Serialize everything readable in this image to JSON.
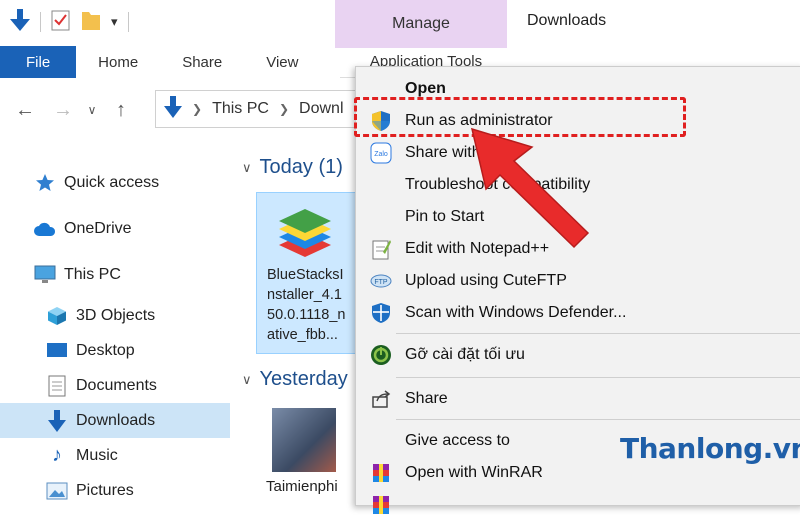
{
  "window": {
    "title": "Downloads"
  },
  "ribbon": {
    "manage_label": "Manage",
    "tabs": [
      {
        "label": "File"
      },
      {
        "label": "Home"
      },
      {
        "label": "Share"
      },
      {
        "label": "View"
      },
      {
        "label": "Application Tools"
      }
    ]
  },
  "address": {
    "crumbs": [
      "This PC",
      "Downl"
    ]
  },
  "sidebar": {
    "items": [
      {
        "label": "Quick access",
        "icon": "star-icon"
      },
      {
        "label": "OneDrive",
        "icon": "cloud-icon"
      },
      {
        "label": "This PC",
        "icon": "monitor-icon"
      },
      {
        "label": "3D Objects",
        "icon": "cube-icon"
      },
      {
        "label": "Desktop",
        "icon": "desktop-icon"
      },
      {
        "label": "Documents",
        "icon": "document-icon"
      },
      {
        "label": "Downloads",
        "icon": "download-icon",
        "selected": true
      },
      {
        "label": "Music",
        "icon": "music-icon"
      },
      {
        "label": "Pictures",
        "icon": "pictures-icon"
      }
    ]
  },
  "content": {
    "today_label": "Today (1)",
    "yesterday_label": "Yesterday",
    "file_name": "BlueStacksI\nnstaller_4.1\n50.0.1118_n\native_fbb...",
    "thumb_name": "Taimienphi"
  },
  "context_menu": {
    "items": [
      {
        "label": "Open",
        "bold": true
      },
      {
        "label": "Run as administrator",
        "icon": "shield-icon"
      },
      {
        "label": "Share with",
        "icon": "zalo-icon"
      },
      {
        "label": "Troubleshoot compatibility"
      },
      {
        "label": "Pin to Start"
      },
      {
        "label": "Edit with Notepad++",
        "icon": "notepad-icon"
      },
      {
        "label": "Upload using CuteFTP",
        "icon": "ftp-icon"
      },
      {
        "label": "Scan with Windows Defender...",
        "icon": "defender-icon"
      },
      {
        "label": "Gỡ cài đặt tối ưu",
        "icon": "uninstall-icon"
      },
      {
        "label": "Share",
        "icon": "share-icon"
      },
      {
        "label": "Give access to"
      },
      {
        "label": "Open with WinRAR",
        "icon": "winrar-icon"
      }
    ]
  },
  "watermark": "Thanlong.vn",
  "colors": {
    "accent": "#1a62b7",
    "selection": "#cce4f7",
    "highlight": "#e02020",
    "manage_bg": "#e9d3f2"
  }
}
